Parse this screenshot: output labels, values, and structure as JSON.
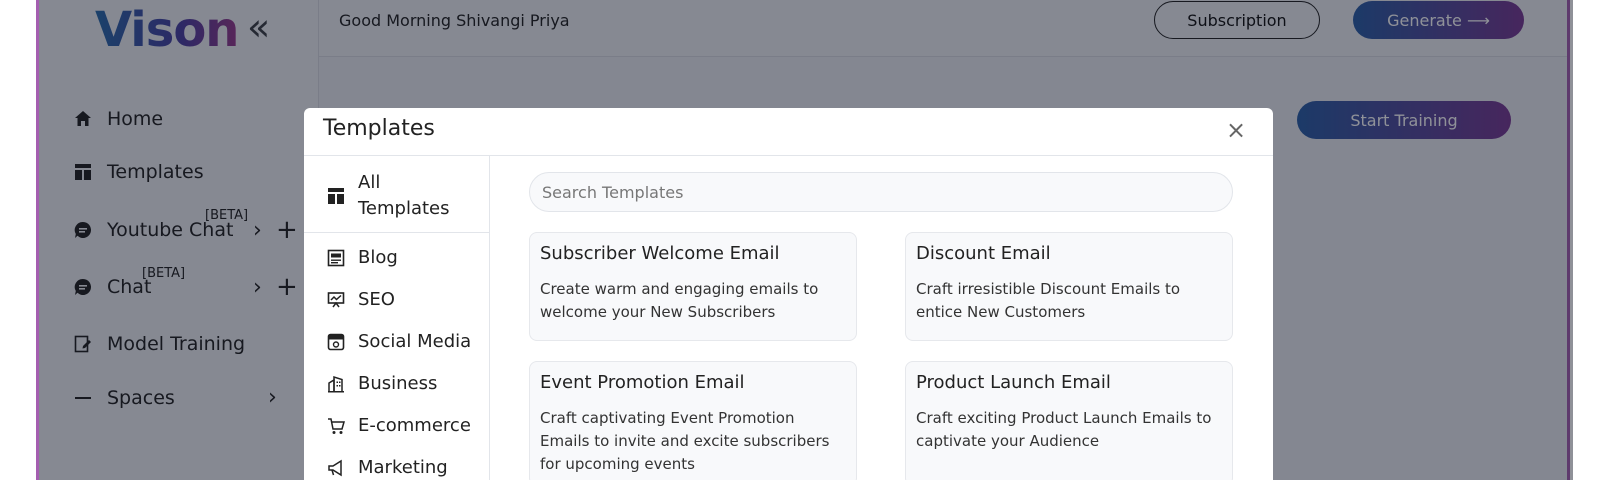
{
  "app": {
    "logo": "Vison"
  },
  "sidebar": {
    "collapse_glyph": "«",
    "items": [
      {
        "label": "Home",
        "icon": "home-icon"
      },
      {
        "label": "Templates",
        "icon": "templates-icon"
      },
      {
        "label": "Youtube Chat",
        "badge": "[BETA]",
        "icon": "chat-bubble-icon"
      },
      {
        "label": "Chat",
        "badge": "[BETA]",
        "icon": "chat-bubble-icon"
      },
      {
        "label": "Model Training",
        "icon": "model-training-icon"
      },
      {
        "label": "Spaces",
        "icon": "minus-icon"
      }
    ]
  },
  "header": {
    "greeting": "Good Morning Shivangi Priya",
    "subscription_label": "Subscription",
    "generate_label": "Generate ⟶"
  },
  "main": {
    "start_training_label": "Start Training"
  },
  "modal": {
    "title": "Templates",
    "close_glyph": "×",
    "search_placeholder": "Search Templates",
    "categories": [
      {
        "label": "All Templates",
        "icon": "templates-icon"
      },
      {
        "label": "Blog",
        "icon": "blog-icon"
      },
      {
        "label": "SEO",
        "icon": "seo-icon"
      },
      {
        "label": "Social Media",
        "icon": "social-media-icon"
      },
      {
        "label": "Business",
        "icon": "business-icon"
      },
      {
        "label": "E-commerce",
        "icon": "cart-icon"
      },
      {
        "label": "Marketing",
        "icon": "megaphone-icon"
      }
    ],
    "cards": [
      {
        "title": "Subscriber Welcome Email",
        "description": "Create warm and engaging emails to welcome your New Subscribers"
      },
      {
        "title": "Discount Email",
        "description": "Craft irresistible Discount Emails to entice New Customers"
      },
      {
        "title": "Event Promotion Email",
        "description": "Craft captivating Event Promotion Emails to invite and excite subscribers for upcoming events"
      },
      {
        "title": "Product Launch Email",
        "description": "Craft exciting Product Launch Emails to captivate your Audience"
      }
    ]
  },
  "colors": {
    "accent_start": "#2b5fa6",
    "accent_end": "#7a3a93",
    "frame_border": "#a45eb0"
  }
}
